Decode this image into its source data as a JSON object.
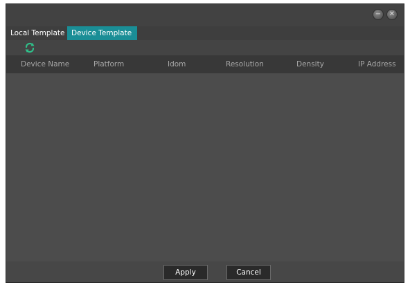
{
  "window": {
    "help_icon": "help-circle-icon",
    "close_icon": "close-icon"
  },
  "tabs": [
    {
      "label": "Local Template",
      "active": false
    },
    {
      "label": "Device Template",
      "active": true
    }
  ],
  "toolbar": {
    "refresh_icon": "refresh-icon"
  },
  "table": {
    "columns": [
      "Device Name",
      "Platform",
      "Idom",
      "Resolution",
      "Density",
      "IP Address"
    ],
    "rows": []
  },
  "footer": {
    "apply_label": "Apply",
    "cancel_label": "Cancel"
  },
  "colors": {
    "active_tab": "#1a8e96",
    "refresh_icon": "#2fc08a"
  }
}
